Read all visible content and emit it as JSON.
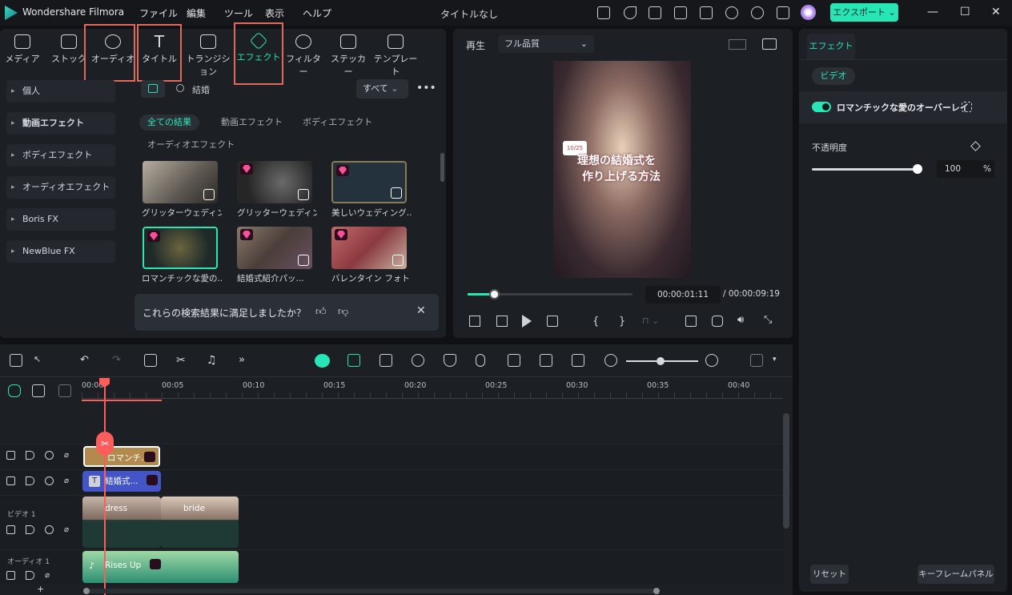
{
  "app": {
    "name": "Wondershare Filmora",
    "window_title": "タイトルなし",
    "export_label": "エクスポート"
  },
  "menu": [
    "ファイル",
    "編集",
    "ツール",
    "表示",
    "ヘルプ"
  ],
  "tabs": [
    {
      "label": "メディア",
      "icon": "media-icon"
    },
    {
      "label": "ストック",
      "icon": "stock-icon"
    },
    {
      "label": "オーディオ",
      "icon": "music-note-icon"
    },
    {
      "label": "タイトル",
      "icon": "title-t-icon"
    },
    {
      "label": "トランジション",
      "icon": "transition-icon"
    },
    {
      "label": "エフェクト",
      "icon": "effect-sparkle-icon"
    },
    {
      "label": "フィルター",
      "icon": "filter-icon"
    },
    {
      "label": "ステッカー",
      "icon": "sticker-icon"
    },
    {
      "label": "テンプレート",
      "icon": "template-icon"
    }
  ],
  "sidebar": [
    "個人",
    "動画エフェクト",
    "ボディエフェクト",
    "オーディオエフェクト",
    "Boris FX",
    "NewBlue FX"
  ],
  "search": {
    "value": "結婚",
    "filter": "すべて"
  },
  "chips": [
    "全ての結果",
    "動画エフェクト",
    "ボディエフェクト",
    "オーディオエフェクト"
  ],
  "results": [
    {
      "label": "グリッターウェディン...",
      "premium": false
    },
    {
      "label": "グリッターウェディン...",
      "premium": true
    },
    {
      "label": "美しいウェディング...",
      "premium": true
    },
    {
      "label": "ロマンチックな愛の...",
      "premium": true
    },
    {
      "label": "結婚式紹介パッ...",
      "premium": true
    },
    {
      "label": "バレンタイン フォト ...",
      "premium": true
    }
  ],
  "feedback": {
    "text": "これらの検索結果に満足しましたか？"
  },
  "player": {
    "play_label": "再生",
    "quality": "フル品質",
    "current_time": "00:00:01:11",
    "total_time": "/  00:00:09:19",
    "progress": 0.16,
    "video_text_line1": "理想の結婚式を",
    "video_text_line2": "作り上げる方法",
    "video_badge": "10/25"
  },
  "right_panel": {
    "tab": "エフェクト",
    "subtab": "ビデオ",
    "effect_name": "ロマンチックな愛のオーバーレイ",
    "opacity_label": "不透明度",
    "opacity_value": "100",
    "opacity_unit": "%",
    "reset_label": "リセット",
    "keyframe_label": "キーフレームパネル"
  },
  "timeline": {
    "ruler": [
      "00:00",
      "00:05",
      "00:10",
      "00:15",
      "00:20",
      "00:25",
      "00:30",
      "00:35",
      "00:40"
    ],
    "tracks": {
      "video1": "ビデオ 1",
      "audio1": "オーディオ 1"
    },
    "clips": {
      "effect": "ロマンチ...",
      "title": "結婚式...",
      "video_a": "dress",
      "video_b": "bride",
      "audio": "Rises Up"
    }
  },
  "colors": {
    "accent": "#27e6b6",
    "highlight": "#e26a5b",
    "playhead": "#ff5c5c"
  }
}
